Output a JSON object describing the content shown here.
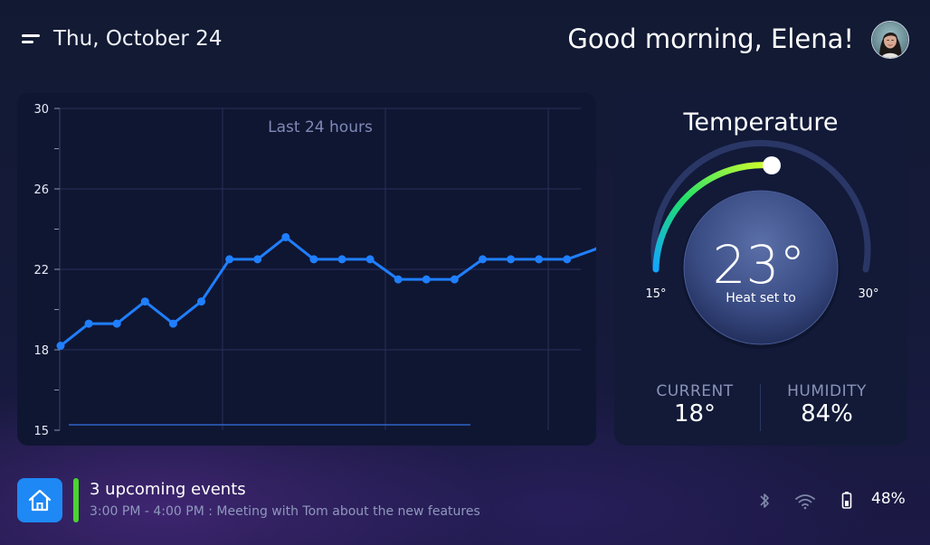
{
  "header": {
    "date": "Thu, October 24",
    "greeting": "Good morning, Elena!"
  },
  "chart_data": {
    "type": "line",
    "title": "Last 24 hours",
    "xlabel": "",
    "ylabel": "",
    "ylim": [
      15,
      30
    ],
    "y_ticks": [
      "30",
      "26",
      "22",
      "18",
      "15"
    ],
    "grid": true,
    "x": [
      0,
      1,
      2,
      3,
      4,
      5,
      6,
      7,
      8,
      9,
      10,
      11,
      12,
      13,
      14,
      15,
      16,
      17,
      18,
      19
    ],
    "series": [
      {
        "values": [
          18.2,
          19.3,
          19.3,
          20.4,
          19.3,
          20.4,
          22.5,
          22.5,
          23.6,
          22.5,
          22.5,
          22.5,
          21.5,
          21.5,
          21.5,
          22.5,
          22.5,
          22.5,
          22.5,
          23.0
        ],
        "color": "#1f7fff"
      }
    ]
  },
  "thermostat": {
    "title": "Temperature",
    "setpoint": "23°",
    "mode_label": "Heat set to",
    "min_label": "15°",
    "max_label": "30°",
    "range": [
      15,
      30
    ],
    "setpoint_value": 23,
    "current_label": "CURRENT",
    "current_value": "18°",
    "humidity_label": "HUMIDITY",
    "humidity_value": "84%"
  },
  "footer": {
    "events_title": "3 upcoming events",
    "events_detail": "3:00 PM - 4:00 PM : Meeting with Tom about the new features",
    "battery": "48%",
    "icons": [
      "home-icon",
      "bluetooth-icon",
      "wifi-icon",
      "battery-icon"
    ]
  },
  "colors": {
    "accent": "#1e88f5",
    "event_bar": "#4bd32f",
    "line": "#1f7fff",
    "panel": "#0f1632"
  }
}
